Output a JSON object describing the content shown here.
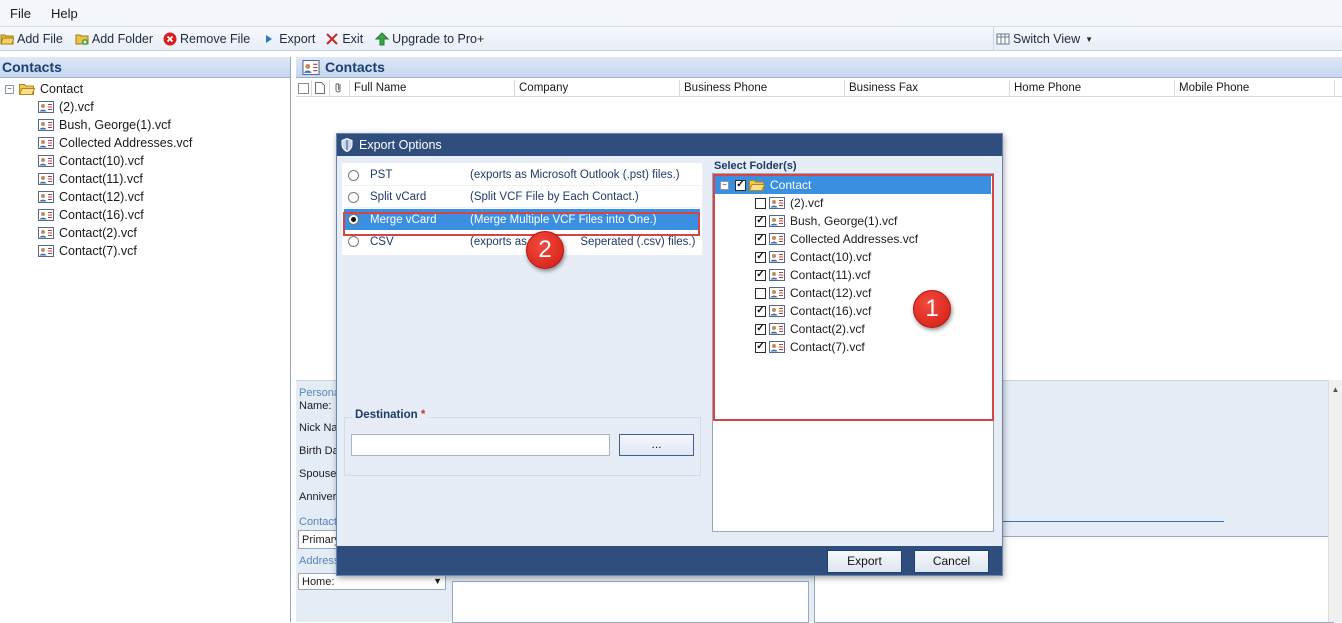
{
  "menu": {
    "file": "File",
    "help": "Help"
  },
  "toolbar": {
    "add_file": "Add File",
    "add_folder": "Add Folder",
    "remove_file": "Remove File",
    "export": "Export",
    "exit": "Exit",
    "upgrade": "Upgrade to Pro+",
    "switch_view": "Switch View"
  },
  "left_panel": {
    "title": "Contacts",
    "root": "Contact",
    "files": [
      "(2).vcf",
      "Bush, George(1).vcf",
      "Collected Addresses.vcf",
      "Contact(10).vcf",
      "Contact(11).vcf",
      "Contact(12).vcf",
      "Contact(16).vcf",
      "Contact(2).vcf",
      "Contact(7).vcf"
    ]
  },
  "main": {
    "title": "Contacts",
    "columns": [
      "Full Name",
      "Company",
      "Business Phone",
      "Business Fax",
      "Home Phone",
      "Mobile Phone"
    ]
  },
  "detail": {
    "personal": "Persona",
    "name": "Name:",
    "nick": "Nick Nar",
    "birth": "Birth Da",
    "spouse": "Spouse",
    "anniv": "Anniver",
    "contact": "Contact",
    "primary": "Primary",
    "address": "Address",
    "home_select": "Home:"
  },
  "dialog": {
    "title": "Export Options",
    "options": [
      {
        "name": "PST",
        "desc": "(exports as Microsoft Outlook (.pst) files.)",
        "selected": false
      },
      {
        "name": "Split vCard",
        "desc": "(Split VCF File by Each Contact.)",
        "selected": false
      },
      {
        "name": "Merge vCard",
        "desc": "(Merge Multiple VCF Files into One.)",
        "selected": true
      },
      {
        "name": "CSV",
        "desc": "(exports as C",
        "desc2": "Seperated (.csv) files.)",
        "selected": false
      }
    ],
    "destination_label": "Destination",
    "required_mark": "*",
    "browse": "...",
    "select_folder_label": "Select Folder(s)",
    "folder_root": "Contact",
    "folder_files": [
      {
        "name": "(2).vcf",
        "checked": false
      },
      {
        "name": "Bush, George(1).vcf",
        "checked": true
      },
      {
        "name": "Collected Addresses.vcf",
        "checked": true
      },
      {
        "name": "Contact(10).vcf",
        "checked": true
      },
      {
        "name": "Contact(11).vcf",
        "checked": true
      },
      {
        "name": "Contact(12).vcf",
        "checked": false
      },
      {
        "name": "Contact(16).vcf",
        "checked": true
      },
      {
        "name": "Contact(2).vcf",
        "checked": true
      },
      {
        "name": "Contact(7).vcf",
        "checked": true
      }
    ],
    "export_btn": "Export",
    "cancel_btn": "Cancel"
  },
  "annotations": {
    "badge1": "1",
    "badge2": "2"
  },
  "colors": {
    "accent_blue": "#2f4e7e",
    "selection": "#3b8fe0",
    "highlight_red": "#d64545"
  },
  "icons": [
    "add-file-icon",
    "add-folder-icon",
    "remove-file-icon",
    "export-icon",
    "exit-icon",
    "upgrade-icon",
    "switch-view-icon",
    "folder-icon",
    "vcard-icon",
    "shield-icon"
  ]
}
